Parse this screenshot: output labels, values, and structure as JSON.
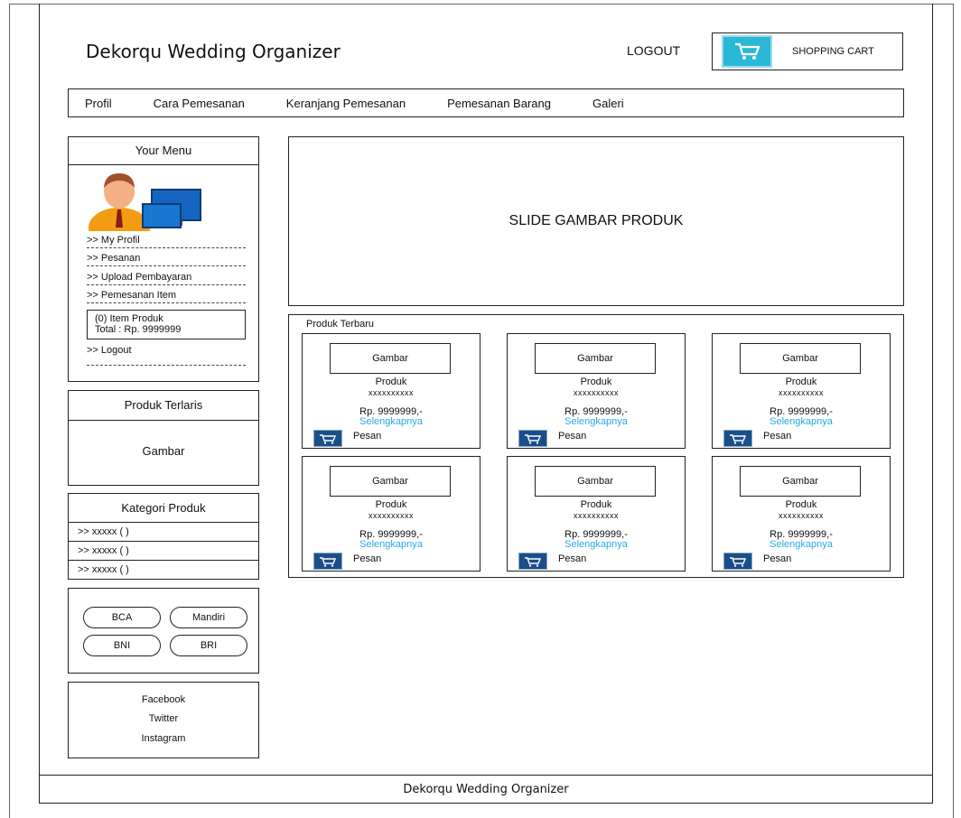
{
  "header": {
    "site_title": "Dekorqu Wedding Organizer",
    "logout_label": "LOGOUT",
    "cart_label": "SHOPPING CART"
  },
  "nav": {
    "items": [
      "Profil",
      "Cara Pemesanan",
      "Keranjang Pemesanan",
      "Pemesanan Barang",
      "Galeri"
    ]
  },
  "sidebar": {
    "menu_title": "Your Menu",
    "menu_items": [
      ">> My Profil",
      ">> Pesanan",
      ">> Upload Pembayaran",
      ">> Pemesanan Item"
    ],
    "cart_summary_line1": "(0) Item Produk",
    "cart_summary_line2": "Total : Rp. 9999999",
    "logout_item": ">> Logout",
    "best_title": "Produk Terlaris",
    "best_image": "Gambar",
    "category_title": "Kategori Produk",
    "categories": [
      ">> xxxxx ( )",
      ">> xxxxx ( )",
      ">> xxxxx ( )"
    ],
    "banks": [
      "BCA",
      "Mandiri",
      "BNI",
      "BRI"
    ],
    "socials": [
      "Facebook",
      "Twitter",
      "Instagram"
    ]
  },
  "main": {
    "slide_text": "SLIDE GAMBAR PRODUK",
    "newest_title": "Produk Terbaru",
    "products": [
      {
        "image": "Gambar",
        "name": "Produk",
        "code": "xxxxxxxxxx",
        "price": "Rp. 9999999,-",
        "more": "Selengkapnya",
        "order": "Pesan"
      },
      {
        "image": "Gambar",
        "name": "Produk",
        "code": "xxxxxxxxxx",
        "price": "Rp. 9999999,-",
        "more": "Selengkapnya",
        "order": "Pesan"
      },
      {
        "image": "Gambar",
        "name": "Produk",
        "code": "xxxxxxxxxx",
        "price": "Rp. 9999999,-",
        "more": "Selengkapnya",
        "order": "Pesan"
      },
      {
        "image": "Gambar",
        "name": "Produk",
        "code": "xxxxxxxxxx",
        "price": "Rp. 9999999,-",
        "more": "Selengkapnya",
        "order": "Pesan"
      },
      {
        "image": "Gambar",
        "name": "Produk",
        "code": "xxxxxxxxxx",
        "price": "Rp. 9999999,-",
        "more": "Selengkapnya",
        "order": "Pesan"
      },
      {
        "image": "Gambar",
        "name": "Produk",
        "code": "xxxxxxxxxx",
        "price": "Rp. 9999999,-",
        "more": "Selengkapnya",
        "order": "Pesan"
      }
    ]
  },
  "footer": {
    "text": "Dekorqu Wedding Organizer"
  },
  "colors": {
    "link": "#2aa8e0",
    "cart_icon": "#2bb8d6",
    "order_icon": "#1a4f8a"
  },
  "icons": [
    "shopping-cart-icon",
    "user-avatar-icon",
    "order-cart-icon"
  ]
}
